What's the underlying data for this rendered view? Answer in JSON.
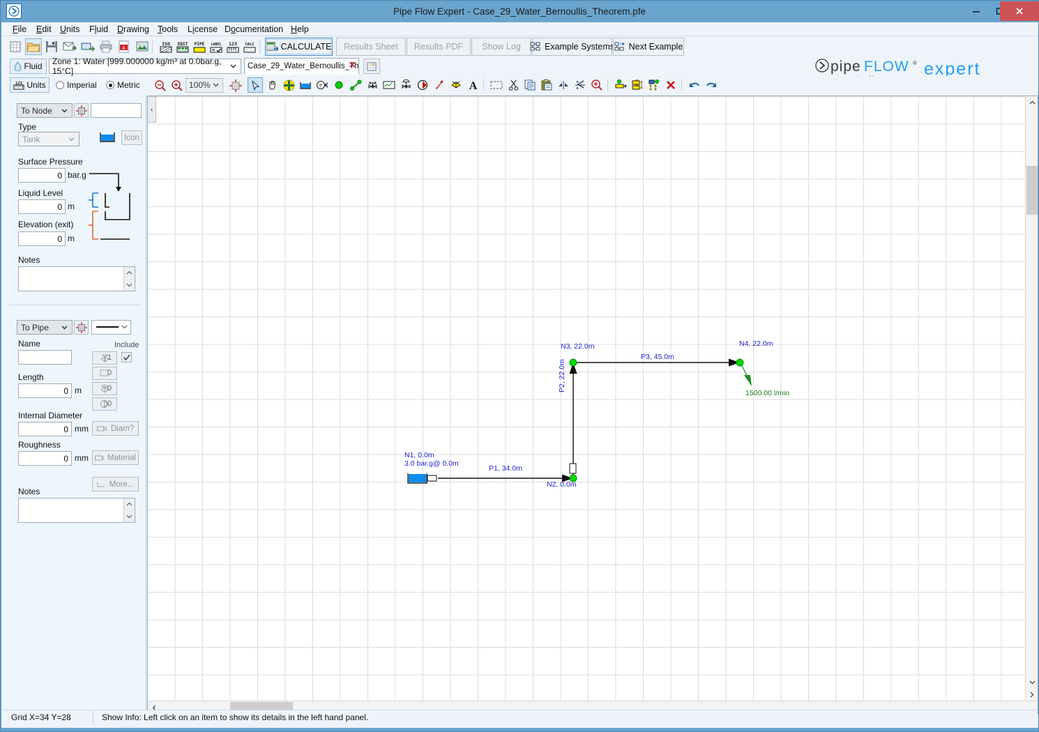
{
  "window": {
    "title": "Pipe Flow Expert - Case_29_Water_Bernoullis_Theorem.pfe",
    "app_icon": "chevron-right-icon",
    "minimize": "–",
    "maximize": "❐",
    "close": "✕"
  },
  "menu": [
    {
      "label": "File",
      "accel": "F"
    },
    {
      "label": "Edit",
      "accel": "E"
    },
    {
      "label": "Units",
      "accel": "U"
    },
    {
      "label": "Fluid",
      "accel": "l"
    },
    {
      "label": "Drawing",
      "accel": "D"
    },
    {
      "label": "Tools",
      "accel": "T"
    },
    {
      "label": "License",
      "accel": "i"
    },
    {
      "label": "Documentation",
      "accel": "o"
    },
    {
      "label": "Help",
      "accel": "H"
    }
  ],
  "toolbar_main": {
    "icons": [
      "new-sheet-icon",
      "open-folder-icon",
      "save-icon",
      "email-icon",
      "export-icon",
      "print-icon",
      "pdf-icon",
      "image-icon",
      "iso-icon",
      "edit-icon",
      "pipe-icon",
      "label-icon",
      "123-icon",
      "calc-icon"
    ],
    "calculate_label": "CALCULATE",
    "results_sheet_label": "Results Sheet",
    "results_pdf_label": "Results PDF",
    "show_log_label": "Show Log",
    "example_systems_label": "Example Systems",
    "next_example_label": "Next Example"
  },
  "fluid_bar": {
    "fluid_button_label": "Fluid",
    "fluid_icon": "water-drop-icon",
    "zone_value": "Zone 1: Water [999.000000 kg/m³ at 0.0bar.g, 15°C]",
    "document_tab": "Case_29_Water_Bernoullis_Th",
    "tab_close": "✕",
    "new_tab_icon": "new-document-icon"
  },
  "units_bar": {
    "units_button_label": "Units",
    "units_icon": "ruler-icon",
    "imperial_label": "Imperial",
    "metric_label": "Metric",
    "selected_system": "Metric",
    "zoom_out_icon": "zoom-out-icon",
    "zoom_in_icon": "zoom-in-icon",
    "zoom_level": "100%",
    "fit_icon": "fit-to-grid-icon"
  },
  "draw_tools": [
    "pointer-tool-icon",
    "pan-hand-tool-icon",
    "move-node-tool-icon",
    "tank-tool-icon",
    "pressure-node-tool-icon",
    "join-node-tool-icon",
    "pipe-tool-icon",
    "valve-tool-icon",
    "component-tool-icon",
    "control-valve-tool-icon",
    "pump-tool-icon",
    "flow-demand-tool-icon",
    "fitting-tool-icon",
    "text-tool-icon",
    "select-rect-icon",
    "cut-icon",
    "copy-icon",
    "paste-icon",
    "flip-vertical-icon",
    "flip-horizontal-icon",
    "zoom-region-icon",
    "align-node-icon",
    "align-horizontal-icon",
    "align-vertical-icon",
    "delete-icon",
    "undo-icon",
    "redo-icon"
  ],
  "node_panel": {
    "selector_value": "To Node",
    "selector_icon": "node-target-icon",
    "name_value": "",
    "type_label": "Type",
    "type_value": "Tank",
    "icon_button_label": "Icon",
    "tank_preview_icon": "tank-icon",
    "surface_pressure_label": "Surface Pressure",
    "surface_pressure_value": "0",
    "surface_pressure_unit": "bar.g",
    "liquid_level_label": "Liquid Level",
    "liquid_level_value": "0",
    "liquid_level_unit": "m",
    "elevation_label": "Elevation (exit)",
    "elevation_value": "0",
    "elevation_unit": "m",
    "notes_label": "Notes",
    "notes_value": ""
  },
  "pipe_panel": {
    "selector_value": "To Pipe",
    "selector_icon": "pipe-target-icon",
    "linestyle_value": "————",
    "name_label": "Name",
    "name_value": "",
    "include_label": "Include",
    "include_checked": true,
    "fitting_count": "1",
    "component_count": "0",
    "valve_count": "0",
    "pump_count": "0",
    "length_label": "Length",
    "length_value": "0",
    "length_unit": "m",
    "internal_diameter_label": "Internal Diameter",
    "internal_diameter_value": "0",
    "internal_diameter_unit": "mm",
    "diam_button_label": "Diam?",
    "roughness_label": "Roughness",
    "roughness_value": "0",
    "roughness_unit": "mm",
    "material_button_label": "Material",
    "more_button_label": "More...",
    "notes_label": "Notes",
    "notes_value": ""
  },
  "canvas": {
    "collapse_handle": "‹",
    "grid_color": "#dcdcdc",
    "node_color": "#00cc00",
    "label_color": "#2222cc",
    "flow_color": "#1f7a1f",
    "nodes": [
      {
        "id": "N1",
        "label": "N1, 0.0m",
        "sublabel": "3.0 bar.g@ 0.0m",
        "type": "tank"
      },
      {
        "id": "N2",
        "label": "N2, 0.0m",
        "type": "join"
      },
      {
        "id": "N3",
        "label": "N3, 22.0m",
        "type": "join"
      },
      {
        "id": "N4",
        "label": "N4, 22.0m",
        "type": "join"
      }
    ],
    "pipes": [
      {
        "id": "P1",
        "label": "P1, 34.0m"
      },
      {
        "id": "P2",
        "label": "P2, 22.0m"
      },
      {
        "id": "P3",
        "label": "P3, 45.0m"
      }
    ],
    "flow_demand": "1500.00 l/min"
  },
  "scrollbars": {
    "v_up": "▲",
    "v_down": "▼",
    "h_left": "◄",
    "h_right": "►"
  },
  "statusbar": {
    "grid_text": "Grid  X=34  Y=28",
    "info_text": "Show Info: Left click on an item to show its details in the left hand panel."
  }
}
